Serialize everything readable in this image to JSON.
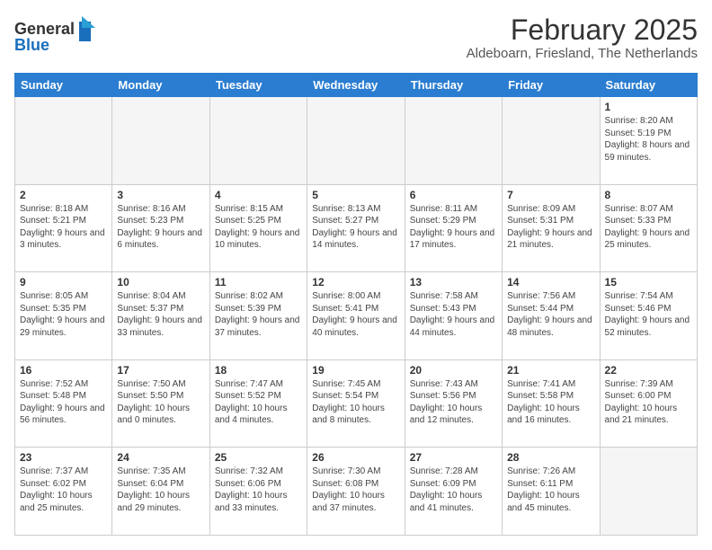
{
  "header": {
    "logo_line1": "General",
    "logo_line2": "Blue",
    "main_title": "February 2025",
    "subtitle": "Aldeboarn, Friesland, The Netherlands"
  },
  "weekdays": [
    "Sunday",
    "Monday",
    "Tuesday",
    "Wednesday",
    "Thursday",
    "Friday",
    "Saturday"
  ],
  "weeks": [
    [
      {
        "day": "",
        "info": ""
      },
      {
        "day": "",
        "info": ""
      },
      {
        "day": "",
        "info": ""
      },
      {
        "day": "",
        "info": ""
      },
      {
        "day": "",
        "info": ""
      },
      {
        "day": "",
        "info": ""
      },
      {
        "day": "1",
        "info": "Sunrise: 8:20 AM\nSunset: 5:19 PM\nDaylight: 8 hours and 59 minutes."
      }
    ],
    [
      {
        "day": "2",
        "info": "Sunrise: 8:18 AM\nSunset: 5:21 PM\nDaylight: 9 hours and 3 minutes."
      },
      {
        "day": "3",
        "info": "Sunrise: 8:16 AM\nSunset: 5:23 PM\nDaylight: 9 hours and 6 minutes."
      },
      {
        "day": "4",
        "info": "Sunrise: 8:15 AM\nSunset: 5:25 PM\nDaylight: 9 hours and 10 minutes."
      },
      {
        "day": "5",
        "info": "Sunrise: 8:13 AM\nSunset: 5:27 PM\nDaylight: 9 hours and 14 minutes."
      },
      {
        "day": "6",
        "info": "Sunrise: 8:11 AM\nSunset: 5:29 PM\nDaylight: 9 hours and 17 minutes."
      },
      {
        "day": "7",
        "info": "Sunrise: 8:09 AM\nSunset: 5:31 PM\nDaylight: 9 hours and 21 minutes."
      },
      {
        "day": "8",
        "info": "Sunrise: 8:07 AM\nSunset: 5:33 PM\nDaylight: 9 hours and 25 minutes."
      }
    ],
    [
      {
        "day": "9",
        "info": "Sunrise: 8:05 AM\nSunset: 5:35 PM\nDaylight: 9 hours and 29 minutes."
      },
      {
        "day": "10",
        "info": "Sunrise: 8:04 AM\nSunset: 5:37 PM\nDaylight: 9 hours and 33 minutes."
      },
      {
        "day": "11",
        "info": "Sunrise: 8:02 AM\nSunset: 5:39 PM\nDaylight: 9 hours and 37 minutes."
      },
      {
        "day": "12",
        "info": "Sunrise: 8:00 AM\nSunset: 5:41 PM\nDaylight: 9 hours and 40 minutes."
      },
      {
        "day": "13",
        "info": "Sunrise: 7:58 AM\nSunset: 5:43 PM\nDaylight: 9 hours and 44 minutes."
      },
      {
        "day": "14",
        "info": "Sunrise: 7:56 AM\nSunset: 5:44 PM\nDaylight: 9 hours and 48 minutes."
      },
      {
        "day": "15",
        "info": "Sunrise: 7:54 AM\nSunset: 5:46 PM\nDaylight: 9 hours and 52 minutes."
      }
    ],
    [
      {
        "day": "16",
        "info": "Sunrise: 7:52 AM\nSunset: 5:48 PM\nDaylight: 9 hours and 56 minutes."
      },
      {
        "day": "17",
        "info": "Sunrise: 7:50 AM\nSunset: 5:50 PM\nDaylight: 10 hours and 0 minutes."
      },
      {
        "day": "18",
        "info": "Sunrise: 7:47 AM\nSunset: 5:52 PM\nDaylight: 10 hours and 4 minutes."
      },
      {
        "day": "19",
        "info": "Sunrise: 7:45 AM\nSunset: 5:54 PM\nDaylight: 10 hours and 8 minutes."
      },
      {
        "day": "20",
        "info": "Sunrise: 7:43 AM\nSunset: 5:56 PM\nDaylight: 10 hours and 12 minutes."
      },
      {
        "day": "21",
        "info": "Sunrise: 7:41 AM\nSunset: 5:58 PM\nDaylight: 10 hours and 16 minutes."
      },
      {
        "day": "22",
        "info": "Sunrise: 7:39 AM\nSunset: 6:00 PM\nDaylight: 10 hours and 21 minutes."
      }
    ],
    [
      {
        "day": "23",
        "info": "Sunrise: 7:37 AM\nSunset: 6:02 PM\nDaylight: 10 hours and 25 minutes."
      },
      {
        "day": "24",
        "info": "Sunrise: 7:35 AM\nSunset: 6:04 PM\nDaylight: 10 hours and 29 minutes."
      },
      {
        "day": "25",
        "info": "Sunrise: 7:32 AM\nSunset: 6:06 PM\nDaylight: 10 hours and 33 minutes."
      },
      {
        "day": "26",
        "info": "Sunrise: 7:30 AM\nSunset: 6:08 PM\nDaylight: 10 hours and 37 minutes."
      },
      {
        "day": "27",
        "info": "Sunrise: 7:28 AM\nSunset: 6:09 PM\nDaylight: 10 hours and 41 minutes."
      },
      {
        "day": "28",
        "info": "Sunrise: 7:26 AM\nSunset: 6:11 PM\nDaylight: 10 hours and 45 minutes."
      },
      {
        "day": "",
        "info": ""
      }
    ]
  ]
}
